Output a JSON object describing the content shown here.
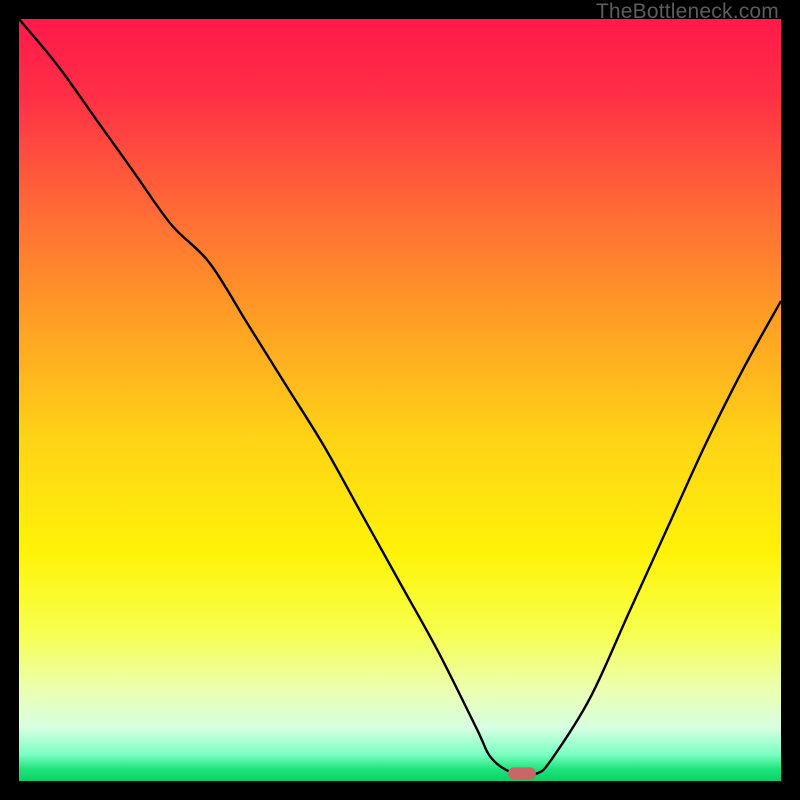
{
  "watermark": "TheBottleneck.com",
  "chart_data": {
    "type": "line",
    "title": "",
    "xlabel": "",
    "ylabel": "",
    "xlim": [
      0,
      100
    ],
    "ylim": [
      0,
      100
    ],
    "x": [
      0,
      5,
      10,
      15,
      20,
      25,
      30,
      35,
      40,
      45,
      50,
      55,
      60,
      62,
      65,
      68,
      70,
      75,
      80,
      85,
      90,
      95,
      100
    ],
    "values": [
      100,
      94,
      87,
      80,
      73,
      68,
      60,
      52,
      44,
      35,
      26,
      17,
      7,
      3,
      1,
      1,
      3,
      11,
      22,
      33,
      44,
      54,
      63
    ],
    "marker": {
      "x": 66,
      "y": 1
    },
    "gradient_stops": [
      {
        "offset": 0.0,
        "color": "#ff1a4a"
      },
      {
        "offset": 0.1,
        "color": "#ff2f46"
      },
      {
        "offset": 0.25,
        "color": "#ff6a36"
      },
      {
        "offset": 0.4,
        "color": "#ffa024"
      },
      {
        "offset": 0.55,
        "color": "#ffd316"
      },
      {
        "offset": 0.7,
        "color": "#fff308"
      },
      {
        "offset": 0.8,
        "color": "#f7ff4a"
      },
      {
        "offset": 0.88,
        "color": "#ecffb0"
      },
      {
        "offset": 0.93,
        "color": "#d7ffe2"
      },
      {
        "offset": 0.965,
        "color": "#7cffc2"
      },
      {
        "offset": 0.985,
        "color": "#1de37a"
      },
      {
        "offset": 1.0,
        "color": "#0ecf69"
      }
    ],
    "marker_color": "#c96666",
    "curve_color": "#000000",
    "grid": false,
    "legend": false
  }
}
